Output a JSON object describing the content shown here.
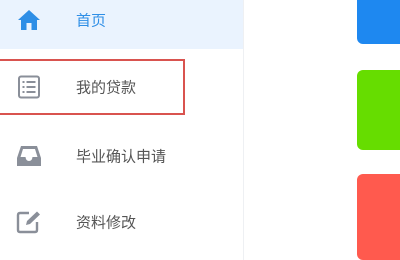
{
  "sidebar": {
    "items": [
      {
        "label": "首页",
        "icon": "home-icon",
        "active": true
      },
      {
        "label": "我的贷款",
        "icon": "list-document-icon",
        "active": false
      },
      {
        "label": "毕业确认申请",
        "icon": "inbox-tray-icon",
        "active": false
      },
      {
        "label": "资料修改",
        "icon": "edit-icon",
        "active": false
      }
    ]
  },
  "colors": {
    "accent": "#2e8ee6",
    "active_bg": "#eaf3fe",
    "icon_gray": "#8a8f99",
    "highlight": "#d9534f",
    "tile_blue": "#1e88f0",
    "tile_green": "#66dd00",
    "tile_red": "#ff5a4e"
  }
}
